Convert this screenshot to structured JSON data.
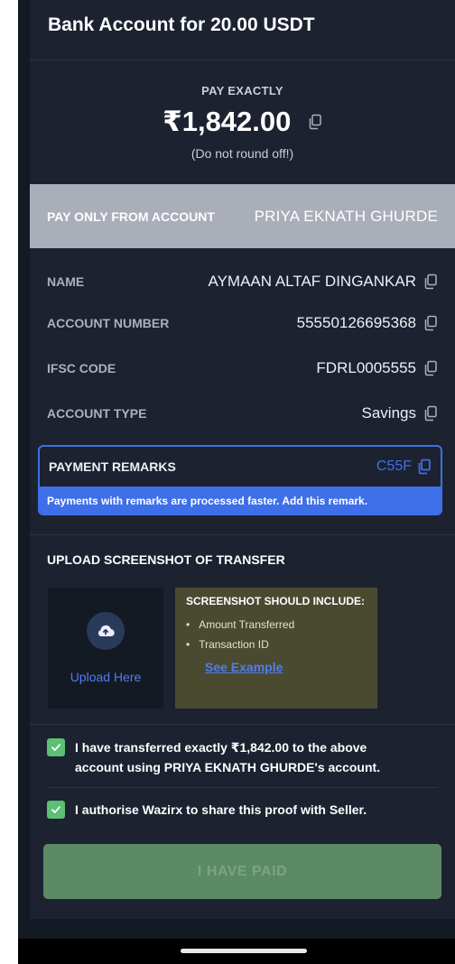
{
  "header": {
    "title": "Bank Account for 20.00 USDT"
  },
  "payment": {
    "pay_label": "PAY EXACTLY",
    "amount": "₹1,842.00",
    "note": "(Do not round off!)"
  },
  "pay_from": {
    "label": "PAY ONLY FROM ACCOUNT",
    "value": "PRIYA EKNATH GHURDE"
  },
  "details": [
    {
      "label": "NAME",
      "value": "AYMAAN ALTAF DINGANKAR"
    },
    {
      "label": "ACCOUNT NUMBER",
      "value": "55550126695368"
    },
    {
      "label": "IFSC CODE",
      "value": "FDRL0005555"
    },
    {
      "label": "ACCOUNT TYPE",
      "value": "Savings"
    }
  ],
  "remarks": {
    "label": "PAYMENT REMARKS",
    "code": "C55F",
    "hint": "Payments with remarks are processed faster. Add this remark."
  },
  "upload": {
    "title": "UPLOAD SCREENSHOT OF TRANSFER",
    "button_label": "Upload Here",
    "hint_title": "SCREENSHOT SHOULD INCLUDE:",
    "hint_items": [
      "Amount Transferred",
      "Transaction ID"
    ],
    "example_link": "See Example"
  },
  "confirmations": [
    {
      "text_line1": "I have transferred exactly ₹1,842.00 to the above",
      "text_line2": "account using PRIYA EKNATH GHURDE's account.",
      "checked": true
    },
    {
      "text_line1": "I authorise Wazirx to share this proof with Seller.",
      "checked": true
    }
  ],
  "action": {
    "button_label": "I HAVE PAID"
  },
  "colors": {
    "background": "#1c2230",
    "accent_blue": "#3f6fe8",
    "check_green": "#5bbf74",
    "button_green": "#5c8a62",
    "band_grey": "#a9aeb8"
  },
  "icons": [
    "copy-icon",
    "cloud-upload-icon",
    "checkmark-icon"
  ]
}
